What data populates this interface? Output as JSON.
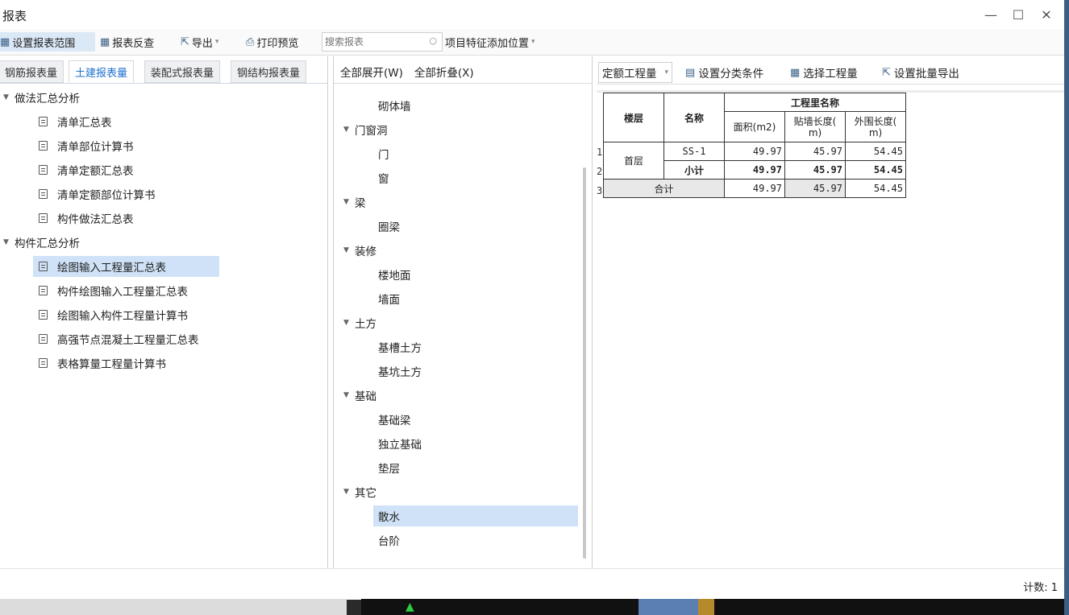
{
  "window": {
    "title": "报表"
  },
  "toolbar": {
    "set_range": "设置报表范围",
    "reverse": "报表反查",
    "export": "导出",
    "print_preview": "打印预览",
    "search_placeholder": "搜索报表",
    "feature_position": "项目特征添加位置"
  },
  "tabs": [
    "钢筋报表量",
    "土建报表量",
    "装配式报表量",
    "钢结构报表量"
  ],
  "left_tree": {
    "group1": "做法汇总分析",
    "group1_items": [
      "清单汇总表",
      "清单部位计算书",
      "清单定额汇总表",
      "清单定额部位计算书",
      "构件做法汇总表"
    ],
    "group2": "构件汇总分析",
    "group2_items": [
      "绘图输入工程量汇总表",
      "构件绘图输入工程量汇总表",
      "绘图输入构件工程量计算书",
      "高强节点混凝土工程量汇总表",
      "表格算量工程量计算书"
    ]
  },
  "middle": {
    "expand_all": "全部展开(W)",
    "collapse_all": "全部折叠(X)",
    "items": [
      {
        "label": "砌体墙",
        "level": 1
      },
      {
        "label": "门窗洞",
        "level": 0
      },
      {
        "label": "门",
        "level": 1
      },
      {
        "label": "窗",
        "level": 1
      },
      {
        "label": "梁",
        "level": 0
      },
      {
        "label": "圈梁",
        "level": 1
      },
      {
        "label": "装修",
        "level": 0
      },
      {
        "label": "楼地面",
        "level": 1
      },
      {
        "label": "墙面",
        "level": 1
      },
      {
        "label": "土方",
        "level": 0
      },
      {
        "label": "基槽土方",
        "level": 1
      },
      {
        "label": "基坑土方",
        "level": 1
      },
      {
        "label": "基础",
        "level": 0
      },
      {
        "label": "基础梁",
        "level": 1
      },
      {
        "label": "独立基础",
        "level": 1
      },
      {
        "label": "垫层",
        "level": 1
      },
      {
        "label": "其它",
        "level": 0
      },
      {
        "label": "散水",
        "level": 1,
        "selected": true
      },
      {
        "label": "台阶",
        "level": 1
      }
    ]
  },
  "right": {
    "dropdown": "定额工程量",
    "set_category": "设置分类条件",
    "select_quantity": "选择工程量",
    "batch_export": "设置批量导出"
  },
  "report": {
    "h_floor": "楼层",
    "h_name": "名称",
    "h_group": "工程里名称",
    "h_area": "面积(m2)",
    "h_wall_len_1": "贴墙长度(",
    "h_wall_len_2": "m)",
    "h_perim_1": "外围长度(",
    "h_perim_2": "m)",
    "row_numbers": [
      "1",
      "2",
      "3"
    ],
    "floor": "首层",
    "r1": {
      "name": "SS-1",
      "area": "49.97",
      "wall": "45.97",
      "perim": "54.45"
    },
    "r2": {
      "name": "小计",
      "area": "49.97",
      "wall": "45.97",
      "perim": "54.45"
    },
    "r3": {
      "name": "合计",
      "area": "49.97",
      "wall": "45.97",
      "perim": "54.45"
    }
  },
  "status": {
    "count": "计数: 1"
  },
  "colors": {
    "accent": "#1e6fd0",
    "selection": "#cfe2f7"
  }
}
